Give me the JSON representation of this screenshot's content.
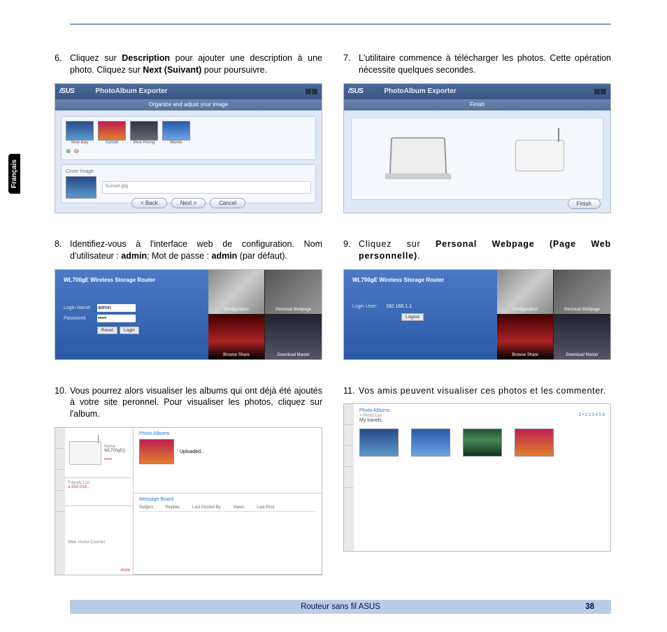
{
  "side_tab": "Français",
  "footer": {
    "title": "Routeur sans fil ASUS",
    "page": "38"
  },
  "steps": {
    "s6": {
      "num": "6.",
      "text_pre": "Cliquez sur ",
      "b1": "Description",
      "text_mid": " pour ajouter une description à une photo. Cliquez sur ",
      "b2": "Next (Suivant)",
      "text_post": " pour poursuivre."
    },
    "s7": {
      "num": "7.",
      "text": "L'utilitaire commence à télécharger les photos. Cette opération nécessite quelques secondes."
    },
    "s8": {
      "num": "8.",
      "text_pre": "Identifiez-vous à l'interface web de configuration. Nom d'utilisateur : ",
      "b1": "admin",
      "text_mid": "; Mot de passe : ",
      "b2": "admin",
      "text_post": " (par défaut)."
    },
    "s9": {
      "num": "9.",
      "text_pre": "Cliquez sur ",
      "b1": "Personal Webpage (Page Web personnelle)",
      "text_post": "."
    },
    "s10": {
      "num": "10.",
      "text": "Vous pourrez alors visualiser les albums qui ont déjà été ajoutés à votre site peronnel. Pour visualiser les photos, cliquez sur l'album."
    },
    "s11": {
      "num": "11.",
      "text": "Vos amis peuvent visualiser ces photos et les commenter."
    }
  },
  "exporter": {
    "brand": "/SUS",
    "title": "PhotoAlbum Exporter",
    "subtitle": "Organize and adjust your image",
    "thumb_labels": [
      "Blue Bay",
      "Sunset",
      "Blue Rising",
      "Waves"
    ],
    "cover_label": "Cover Image",
    "cover_file": "Sunset.jpg",
    "btn_back": "< Back",
    "btn_next": "Next >",
    "btn_cancel": "Cancel"
  },
  "finish": {
    "brand": "/SUS",
    "title": "PhotoAlbum Exporter",
    "subtitle": "Finish",
    "btn_finish": "Finish"
  },
  "login": {
    "header": "WL700gE Wireless Storage Router",
    "user_label": "Login Name:",
    "pass_label": "Password:",
    "user_value": "admin",
    "pass_value": "•••••",
    "btn_reset": "Reset",
    "btn_login": "Login",
    "tiles": [
      "Configuration",
      "Personal Webpage",
      "Browse Share",
      "Download Master"
    ]
  },
  "config": {
    "header": "WL700gE Wireless Storage Router",
    "login_label": "Login User:",
    "login_value": "192.168.1.1",
    "btn_logout": "Logout",
    "tiles": [
      "Configuration",
      "Personal Webpage",
      "Browse Share",
      "Download Master"
    ]
  },
  "album": {
    "router_name": "WL700gE()",
    "hdr1": "Photo Albums",
    "album_caption": "Uploaded...",
    "friend_h": "Friends List",
    "friend_item": "a 202-014...",
    "msg_h": "Message Board",
    "msg_cols": [
      "Subject",
      "Replies",
      "Last Posted By",
      "Views",
      "Last Post"
    ],
    "visitors_h": "Web Visitor Counter"
  },
  "friend": {
    "hdr": "Photo Albums",
    "sub": "> Photo List",
    "nums": "1 • 1 2 3 4 5 6",
    "title": "My travels"
  }
}
